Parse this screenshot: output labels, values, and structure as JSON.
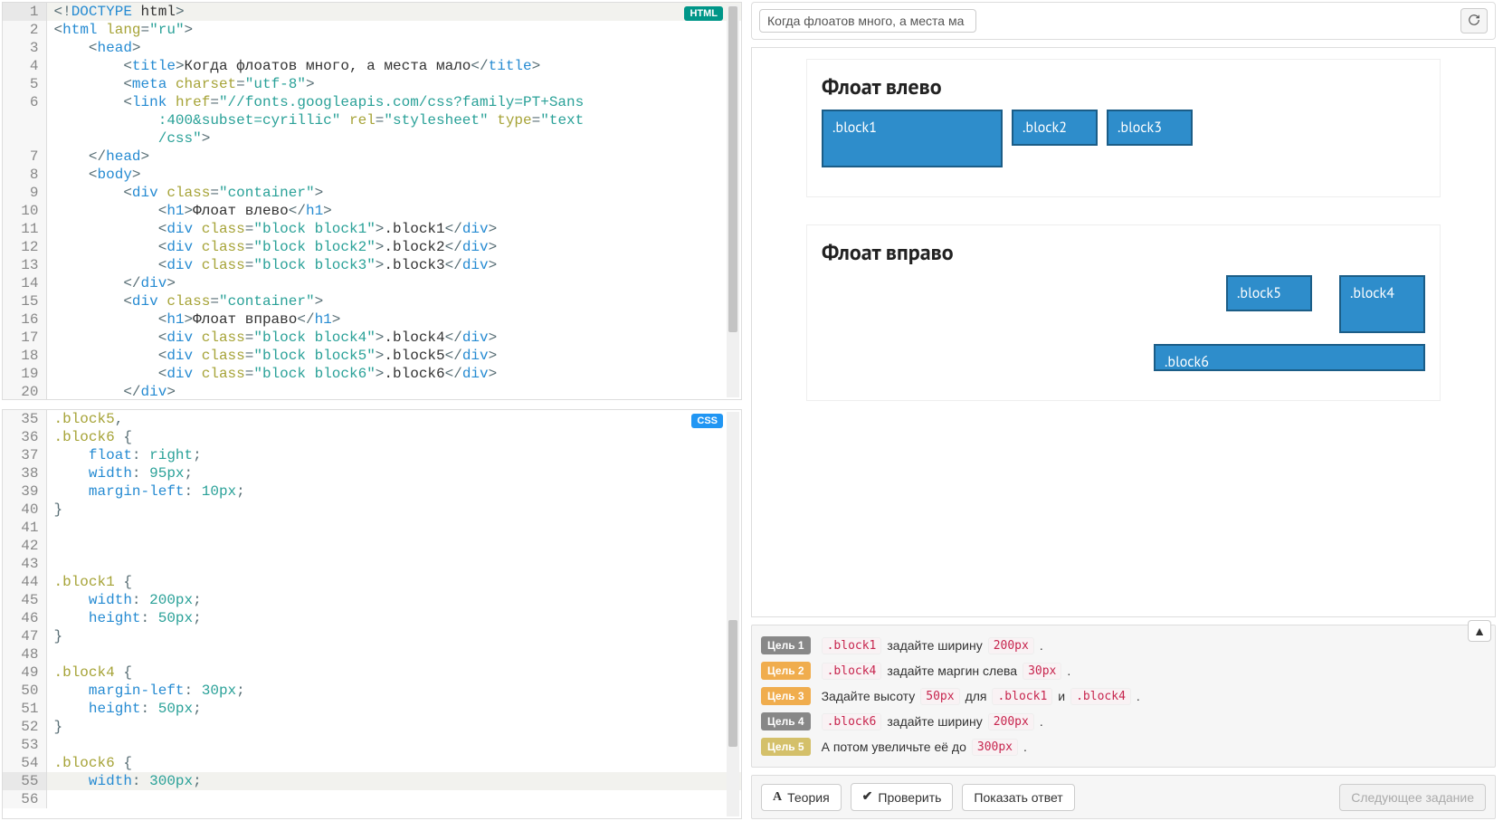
{
  "editor": {
    "html_badge": "HTML",
    "css_badge": "CSS",
    "html_lines": [
      {
        "n": 1,
        "hl": true,
        "tokens": [
          [
            "punc",
            "<!"
          ],
          [
            "tag",
            "DOCTYPE"
          ],
          [
            "txt",
            " html"
          ],
          [
            "punc",
            ">"
          ]
        ]
      },
      {
        "n": 2,
        "tokens": [
          [
            "punc",
            "<"
          ],
          [
            "tag",
            "html"
          ],
          [
            "txt",
            " "
          ],
          [
            "attr",
            "lang"
          ],
          [
            "punc",
            "="
          ],
          [
            "str",
            "\"ru\""
          ],
          [
            "punc",
            ">"
          ]
        ]
      },
      {
        "n": 3,
        "tokens": [
          [
            "txt",
            "    "
          ],
          [
            "punc",
            "<"
          ],
          [
            "tag",
            "head"
          ],
          [
            "punc",
            ">"
          ]
        ]
      },
      {
        "n": 4,
        "tokens": [
          [
            "txt",
            "        "
          ],
          [
            "punc",
            "<"
          ],
          [
            "tag",
            "title"
          ],
          [
            "punc",
            ">"
          ],
          [
            "txt",
            "Когда флоатов много, а места мало"
          ],
          [
            "punc",
            "</"
          ],
          [
            "tag",
            "title"
          ],
          [
            "punc",
            ">"
          ]
        ]
      },
      {
        "n": 5,
        "tokens": [
          [
            "txt",
            "        "
          ],
          [
            "punc",
            "<"
          ],
          [
            "tag",
            "meta"
          ],
          [
            "txt",
            " "
          ],
          [
            "attr",
            "charset"
          ],
          [
            "punc",
            "="
          ],
          [
            "str",
            "\"utf-8\""
          ],
          [
            "punc",
            ">"
          ]
        ]
      },
      {
        "n": 6,
        "tokens": [
          [
            "txt",
            "        "
          ],
          [
            "punc",
            "<"
          ],
          [
            "tag",
            "link"
          ],
          [
            "txt",
            " "
          ],
          [
            "attr",
            "href"
          ],
          [
            "punc",
            "="
          ],
          [
            "str",
            "\"//fonts.googleapis.com/css?family=PT+Sans"
          ]
        ]
      },
      {
        "n": "",
        "tokens": [
          [
            "txt",
            "            "
          ],
          [
            "str",
            ":400&subset=cyrillic\""
          ],
          [
            "txt",
            " "
          ],
          [
            "attr",
            "rel"
          ],
          [
            "punc",
            "="
          ],
          [
            "str",
            "\"stylesheet\""
          ],
          [
            "txt",
            " "
          ],
          [
            "attr",
            "type"
          ],
          [
            "punc",
            "="
          ],
          [
            "str",
            "\"text"
          ]
        ]
      },
      {
        "n": "",
        "tokens": [
          [
            "txt",
            "            "
          ],
          [
            "str",
            "/css\""
          ],
          [
            "punc",
            ">"
          ]
        ]
      },
      {
        "n": 7,
        "tokens": [
          [
            "txt",
            "    "
          ],
          [
            "punc",
            "</"
          ],
          [
            "tag",
            "head"
          ],
          [
            "punc",
            ">"
          ]
        ]
      },
      {
        "n": 8,
        "tokens": [
          [
            "txt",
            "    "
          ],
          [
            "punc",
            "<"
          ],
          [
            "tag",
            "body"
          ],
          [
            "punc",
            ">"
          ]
        ]
      },
      {
        "n": 9,
        "tokens": [
          [
            "txt",
            "        "
          ],
          [
            "punc",
            "<"
          ],
          [
            "tag",
            "div"
          ],
          [
            "txt",
            " "
          ],
          [
            "attr",
            "class"
          ],
          [
            "punc",
            "="
          ],
          [
            "str",
            "\"container\""
          ],
          [
            "punc",
            ">"
          ]
        ]
      },
      {
        "n": 10,
        "tokens": [
          [
            "txt",
            "            "
          ],
          [
            "punc",
            "<"
          ],
          [
            "tag",
            "h1"
          ],
          [
            "punc",
            ">"
          ],
          [
            "txt",
            "Флоат влево"
          ],
          [
            "punc",
            "</"
          ],
          [
            "tag",
            "h1"
          ],
          [
            "punc",
            ">"
          ]
        ]
      },
      {
        "n": 11,
        "tokens": [
          [
            "txt",
            "            "
          ],
          [
            "punc",
            "<"
          ],
          [
            "tag",
            "div"
          ],
          [
            "txt",
            " "
          ],
          [
            "attr",
            "class"
          ],
          [
            "punc",
            "="
          ],
          [
            "str",
            "\"block block1\""
          ],
          [
            "punc",
            ">"
          ],
          [
            "txt",
            ".block1"
          ],
          [
            "punc",
            "</"
          ],
          [
            "tag",
            "div"
          ],
          [
            "punc",
            ">"
          ]
        ]
      },
      {
        "n": 12,
        "tokens": [
          [
            "txt",
            "            "
          ],
          [
            "punc",
            "<"
          ],
          [
            "tag",
            "div"
          ],
          [
            "txt",
            " "
          ],
          [
            "attr",
            "class"
          ],
          [
            "punc",
            "="
          ],
          [
            "str",
            "\"block block2\""
          ],
          [
            "punc",
            ">"
          ],
          [
            "txt",
            ".block2"
          ],
          [
            "punc",
            "</"
          ],
          [
            "tag",
            "div"
          ],
          [
            "punc",
            ">"
          ]
        ]
      },
      {
        "n": 13,
        "tokens": [
          [
            "txt",
            "            "
          ],
          [
            "punc",
            "<"
          ],
          [
            "tag",
            "div"
          ],
          [
            "txt",
            " "
          ],
          [
            "attr",
            "class"
          ],
          [
            "punc",
            "="
          ],
          [
            "str",
            "\"block block3\""
          ],
          [
            "punc",
            ">"
          ],
          [
            "txt",
            ".block3"
          ],
          [
            "punc",
            "</"
          ],
          [
            "tag",
            "div"
          ],
          [
            "punc",
            ">"
          ]
        ]
      },
      {
        "n": 14,
        "tokens": [
          [
            "txt",
            "        "
          ],
          [
            "punc",
            "</"
          ],
          [
            "tag",
            "div"
          ],
          [
            "punc",
            ">"
          ]
        ]
      },
      {
        "n": 15,
        "tokens": [
          [
            "txt",
            "        "
          ],
          [
            "punc",
            "<"
          ],
          [
            "tag",
            "div"
          ],
          [
            "txt",
            " "
          ],
          [
            "attr",
            "class"
          ],
          [
            "punc",
            "="
          ],
          [
            "str",
            "\"container\""
          ],
          [
            "punc",
            ">"
          ]
        ]
      },
      {
        "n": 16,
        "tokens": [
          [
            "txt",
            "            "
          ],
          [
            "punc",
            "<"
          ],
          [
            "tag",
            "h1"
          ],
          [
            "punc",
            ">"
          ],
          [
            "txt",
            "Флоат вправо"
          ],
          [
            "punc",
            "</"
          ],
          [
            "tag",
            "h1"
          ],
          [
            "punc",
            ">"
          ]
        ]
      },
      {
        "n": 17,
        "tokens": [
          [
            "txt",
            "            "
          ],
          [
            "punc",
            "<"
          ],
          [
            "tag",
            "div"
          ],
          [
            "txt",
            " "
          ],
          [
            "attr",
            "class"
          ],
          [
            "punc",
            "="
          ],
          [
            "str",
            "\"block block4\""
          ],
          [
            "punc",
            ">"
          ],
          [
            "txt",
            ".block4"
          ],
          [
            "punc",
            "</"
          ],
          [
            "tag",
            "div"
          ],
          [
            "punc",
            ">"
          ]
        ]
      },
      {
        "n": 18,
        "tokens": [
          [
            "txt",
            "            "
          ],
          [
            "punc",
            "<"
          ],
          [
            "tag",
            "div"
          ],
          [
            "txt",
            " "
          ],
          [
            "attr",
            "class"
          ],
          [
            "punc",
            "="
          ],
          [
            "str",
            "\"block block5\""
          ],
          [
            "punc",
            ">"
          ],
          [
            "txt",
            ".block5"
          ],
          [
            "punc",
            "</"
          ],
          [
            "tag",
            "div"
          ],
          [
            "punc",
            ">"
          ]
        ]
      },
      {
        "n": 19,
        "tokens": [
          [
            "txt",
            "            "
          ],
          [
            "punc",
            "<"
          ],
          [
            "tag",
            "div"
          ],
          [
            "txt",
            " "
          ],
          [
            "attr",
            "class"
          ],
          [
            "punc",
            "="
          ],
          [
            "str",
            "\"block block6\""
          ],
          [
            "punc",
            ">"
          ],
          [
            "txt",
            ".block6"
          ],
          [
            "punc",
            "</"
          ],
          [
            "tag",
            "div"
          ],
          [
            "punc",
            ">"
          ]
        ]
      },
      {
        "n": 20,
        "tokens": [
          [
            "txt",
            "        "
          ],
          [
            "punc",
            "</"
          ],
          [
            "tag",
            "div"
          ],
          [
            "punc",
            ">"
          ]
        ]
      }
    ],
    "css_lines": [
      {
        "n": 35,
        "tokens": [
          [
            "sel",
            ".block5"
          ],
          [
            "punc",
            ","
          ]
        ]
      },
      {
        "n": 36,
        "tokens": [
          [
            "sel",
            ".block6"
          ],
          [
            "txt",
            " "
          ],
          [
            "punc",
            "{"
          ]
        ]
      },
      {
        "n": 37,
        "tokens": [
          [
            "txt",
            "    "
          ],
          [
            "prop",
            "float"
          ],
          [
            "punc",
            ": "
          ],
          [
            "val",
            "right"
          ],
          [
            "punc",
            ";"
          ]
        ]
      },
      {
        "n": 38,
        "tokens": [
          [
            "txt",
            "    "
          ],
          [
            "prop",
            "width"
          ],
          [
            "punc",
            ": "
          ],
          [
            "num",
            "95px"
          ],
          [
            "punc",
            ";"
          ]
        ]
      },
      {
        "n": 39,
        "tokens": [
          [
            "txt",
            "    "
          ],
          [
            "prop",
            "margin-left"
          ],
          [
            "punc",
            ": "
          ],
          [
            "num",
            "10px"
          ],
          [
            "punc",
            ";"
          ]
        ]
      },
      {
        "n": 40,
        "tokens": [
          [
            "punc",
            "}"
          ]
        ]
      },
      {
        "n": 41,
        "tokens": []
      },
      {
        "n": 42,
        "tokens": []
      },
      {
        "n": 43,
        "tokens": []
      },
      {
        "n": 44,
        "tokens": [
          [
            "sel",
            ".block1"
          ],
          [
            "txt",
            " "
          ],
          [
            "punc",
            "{"
          ]
        ]
      },
      {
        "n": 45,
        "tokens": [
          [
            "txt",
            "    "
          ],
          [
            "prop",
            "width"
          ],
          [
            "punc",
            ": "
          ],
          [
            "num",
            "200px"
          ],
          [
            "punc",
            ";"
          ]
        ]
      },
      {
        "n": 46,
        "tokens": [
          [
            "txt",
            "    "
          ],
          [
            "prop",
            "height"
          ],
          [
            "punc",
            ": "
          ],
          [
            "num",
            "50px"
          ],
          [
            "punc",
            ";"
          ]
        ]
      },
      {
        "n": 47,
        "tokens": [
          [
            "punc",
            "}"
          ]
        ]
      },
      {
        "n": 48,
        "tokens": []
      },
      {
        "n": 49,
        "tokens": [
          [
            "sel",
            ".block4"
          ],
          [
            "txt",
            " "
          ],
          [
            "punc",
            "{"
          ]
        ]
      },
      {
        "n": 50,
        "tokens": [
          [
            "txt",
            "    "
          ],
          [
            "prop",
            "margin-left"
          ],
          [
            "punc",
            ": "
          ],
          [
            "num",
            "30px"
          ],
          [
            "punc",
            ";"
          ]
        ]
      },
      {
        "n": 51,
        "tokens": [
          [
            "txt",
            "    "
          ],
          [
            "prop",
            "height"
          ],
          [
            "punc",
            ": "
          ],
          [
            "num",
            "50px"
          ],
          [
            "punc",
            ";"
          ]
        ]
      },
      {
        "n": 52,
        "tokens": [
          [
            "punc",
            "}"
          ]
        ]
      },
      {
        "n": 53,
        "tokens": []
      },
      {
        "n": 54,
        "tokens": [
          [
            "sel",
            ".block6"
          ],
          [
            "txt",
            " "
          ],
          [
            "punc",
            "{"
          ]
        ]
      },
      {
        "n": 55,
        "hl": true,
        "tokens": [
          [
            "txt",
            "    "
          ],
          [
            "prop",
            "width"
          ],
          [
            "punc",
            ": "
          ],
          [
            "num",
            "300px"
          ],
          [
            "punc",
            ";"
          ]
        ]
      },
      {
        "n": 56,
        "tokens": []
      }
    ]
  },
  "preview": {
    "address": "Когда флоатов много, а места ма",
    "container1_title": "Флоат влево",
    "container2_title": "Флоат вправо",
    "blocks": {
      "b1": ".block1",
      "b2": ".block2",
      "b3": ".block3",
      "b4": ".block4",
      "b5": ".block5",
      "b6": ".block6"
    }
  },
  "goals": {
    "items": [
      {
        "tag": "Цель 1",
        "cls": "g1",
        "parts": [
          [
            "code",
            ".block1"
          ],
          [
            "txt",
            " задайте ширину "
          ],
          [
            "code",
            "200px"
          ],
          [
            "txt",
            " ."
          ]
        ]
      },
      {
        "tag": "Цель 2",
        "cls": "g2",
        "parts": [
          [
            "code",
            ".block4"
          ],
          [
            "txt",
            " задайте маргин слева "
          ],
          [
            "code",
            "30px"
          ],
          [
            "txt",
            " ."
          ]
        ]
      },
      {
        "tag": "Цель 3",
        "cls": "g3",
        "parts": [
          [
            "txt",
            "Задайте высоту "
          ],
          [
            "code",
            "50px"
          ],
          [
            "txt",
            " для "
          ],
          [
            "code",
            ".block1"
          ],
          [
            "txt",
            " и "
          ],
          [
            "code",
            ".block4"
          ],
          [
            "txt",
            " ."
          ]
        ]
      },
      {
        "tag": "Цель 4",
        "cls": "g4",
        "parts": [
          [
            "code",
            ".block6"
          ],
          [
            "txt",
            " задайте ширину "
          ],
          [
            "code",
            "200px"
          ],
          [
            "txt",
            " ."
          ]
        ]
      },
      {
        "tag": "Цель 5",
        "cls": "g5",
        "parts": [
          [
            "txt",
            "А потом увеличьте её до "
          ],
          [
            "code",
            "300px"
          ],
          [
            "txt",
            " ."
          ]
        ]
      }
    ]
  },
  "buttons": {
    "theory": "Теория",
    "check": "Проверить",
    "show_answer": "Показать ответ",
    "next": "Следующее задание"
  }
}
